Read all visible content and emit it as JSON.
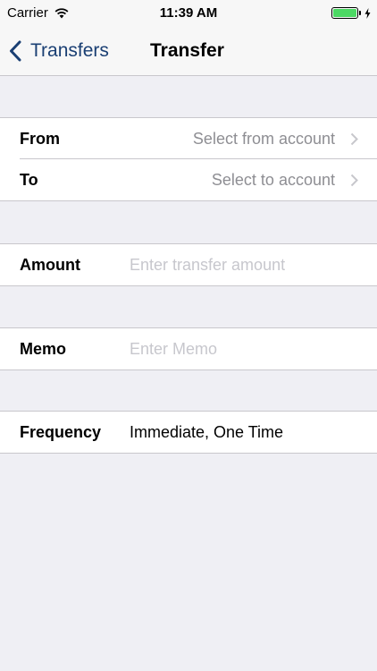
{
  "status_bar": {
    "carrier": "Carrier",
    "time": "11:39 AM",
    "battery_color": "#4cd964",
    "icons": [
      "wifi-icon",
      "battery-icon",
      "charging-bolt-icon"
    ]
  },
  "nav": {
    "back_label": "Transfers",
    "title": "Transfer",
    "tint_color": "#1a3f73",
    "icons": [
      "back-chevron-icon"
    ]
  },
  "accounts": {
    "from_label": "From",
    "from_value": "Select from account",
    "to_label": "To",
    "to_value": "Select to account",
    "icons": [
      "disclosure-chevron-icon"
    ]
  },
  "amount": {
    "label": "Amount",
    "value": "",
    "placeholder": "Enter transfer amount"
  },
  "memo": {
    "label": "Memo",
    "value": "",
    "placeholder": "Enter Memo"
  },
  "frequency": {
    "label": "Frequency",
    "value": "Immediate, One Time"
  }
}
